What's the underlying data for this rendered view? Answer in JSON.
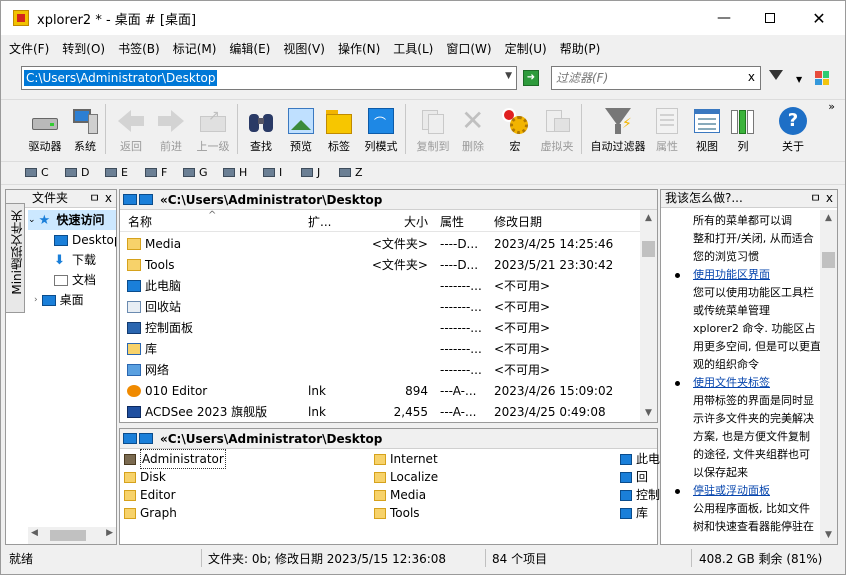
{
  "window": {
    "title": "xplorer2 * - 桌面 # [桌面]"
  },
  "menu": [
    "文件(F)",
    "转到(O)",
    "书签(B)",
    "标记(M)",
    "编辑(E)",
    "视图(V)",
    "操作(N)",
    "工具(L)",
    "窗口(W)",
    "定制(U)",
    "帮助(P)"
  ],
  "address": {
    "value": "C:\\Users\\Administrator\\Desktop",
    "filter_placeholder": "过滤器(F)",
    "filter_clear": "x"
  },
  "toolbar": [
    {
      "label": "驱动器",
      "enabled": true
    },
    {
      "label": "系统",
      "enabled": true
    },
    {
      "label": "返回",
      "enabled": false
    },
    {
      "label": "前进",
      "enabled": false
    },
    {
      "label": "上一级",
      "enabled": false
    },
    {
      "label": "查找",
      "enabled": true
    },
    {
      "label": "预览",
      "enabled": true
    },
    {
      "label": "标签",
      "enabled": true
    },
    {
      "label": "列模式",
      "enabled": true
    },
    {
      "label": "复制到",
      "enabled": false
    },
    {
      "label": "删除",
      "enabled": false
    },
    {
      "label": "宏",
      "enabled": true
    },
    {
      "label": "虚拟夹",
      "enabled": false
    },
    {
      "label": "自动过滤器",
      "enabled": true
    },
    {
      "label": "属性",
      "enabled": false
    },
    {
      "label": "视图",
      "enabled": true
    },
    {
      "label": "列",
      "enabled": true
    },
    {
      "label": "关于",
      "enabled": true
    }
  ],
  "toolbar_more": "»",
  "drives": [
    "C",
    "D",
    "E",
    "F",
    "G",
    "H",
    "I",
    "J",
    "Z"
  ],
  "left_pane": {
    "title": "文件夹",
    "pin": "ㅁ",
    "close": "x",
    "vertical_tab": "Mini虚拟文件夹",
    "tree": [
      "快速访问",
      "Desktop",
      "下载",
      "文档",
      "桌面"
    ]
  },
  "main_pane": {
    "path": "«C:\\Users\\Administrator\\Desktop",
    "columns": {
      "name": "名称",
      "ext": "扩...",
      "size": "大小",
      "attr": "属性",
      "date": "修改日期"
    },
    "rows": [
      {
        "name": "Media",
        "ext": "",
        "size": "<文件夹>",
        "attr": "----D...",
        "date": "2023/4/25 14:25:46"
      },
      {
        "name": "Tools",
        "ext": "",
        "size": "<文件夹>",
        "attr": "----D...",
        "date": "2023/5/21 23:30:42"
      },
      {
        "name": "此电脑",
        "ext": "",
        "size": "",
        "attr": "-------...",
        "date": "<不可用>"
      },
      {
        "name": "回收站",
        "ext": "",
        "size": "",
        "attr": "-------...",
        "date": "<不可用>"
      },
      {
        "name": "控制面板",
        "ext": "",
        "size": "",
        "attr": "-------...",
        "date": "<不可用>"
      },
      {
        "name": "库",
        "ext": "",
        "size": "",
        "attr": "-------...",
        "date": "<不可用>"
      },
      {
        "name": "网络",
        "ext": "",
        "size": "",
        "attr": "-------...",
        "date": "<不可用>"
      },
      {
        "name": "010 Editor",
        "ext": "lnk",
        "size": "894",
        "attr": "---A-...",
        "date": "2023/4/26 15:09:02"
      },
      {
        "name": "ACDSee 2023 旗舰版",
        "ext": "lnk",
        "size": "2,455",
        "attr": "---A-...",
        "date": "2023/4/25 0:49:08"
      }
    ]
  },
  "lower_pane": {
    "path": "«C:\\Users\\Administrator\\Desktop",
    "col1": [
      "Administrator",
      "Disk",
      "Editor",
      "Graph"
    ],
    "col2": [
      "Internet",
      "Localize",
      "Media",
      "Tools"
    ],
    "col3": [
      "此电",
      "回",
      "控制",
      "库"
    ]
  },
  "right_pane": {
    "title": "我该怎么做?...",
    "lines": [
      {
        "t": "所有的菜单都可以调",
        "link": false,
        "bullet": false
      },
      {
        "t": "整和打开/关闭, 从而适合",
        "link": false,
        "bullet": false
      },
      {
        "t": "您的浏览习惯",
        "link": false,
        "bullet": false
      },
      {
        "t": "使用功能区界面",
        "link": true,
        "bullet": true
      },
      {
        "t": "您可以使用功能区工具栏",
        "link": false,
        "bullet": false
      },
      {
        "t": "或传统菜单管理",
        "link": false,
        "bullet": false
      },
      {
        "t": "xplorer2 命令. 功能区占",
        "link": false,
        "bullet": false
      },
      {
        "t": "用更多空间, 但是可以更直",
        "link": false,
        "bullet": false
      },
      {
        "t": "观的组织命令",
        "link": false,
        "bullet": false
      },
      {
        "t": "使用文件夹标签",
        "link": true,
        "bullet": true
      },
      {
        "t": "用带标签的界面是同时显",
        "link": false,
        "bullet": false
      },
      {
        "t": "示许多文件夹的完美解决",
        "link": false,
        "bullet": false
      },
      {
        "t": "方案, 也是方便文件复制",
        "link": false,
        "bullet": false
      },
      {
        "t": "的途径, 文件夹组群也可",
        "link": false,
        "bullet": false
      },
      {
        "t": "以保存起来",
        "link": false,
        "bullet": false
      },
      {
        "t": "停驻或浮动面板",
        "link": true,
        "bullet": true
      },
      {
        "t": "公用程序面板, 比如文件",
        "link": false,
        "bullet": false
      },
      {
        "t": "树和快速查看器能停驻在",
        "link": false,
        "bullet": false
      }
    ]
  },
  "status": {
    "ready": "就绪",
    "info": "文件夹: 0b; 修改日期 2023/5/15 12:36:08",
    "count": "84 个项目",
    "free": "408.2 GB 剩余 (81%)"
  },
  "colors": {
    "accent": "#0078d7",
    "folder": "#f7d26a",
    "link": "#0645ad"
  }
}
